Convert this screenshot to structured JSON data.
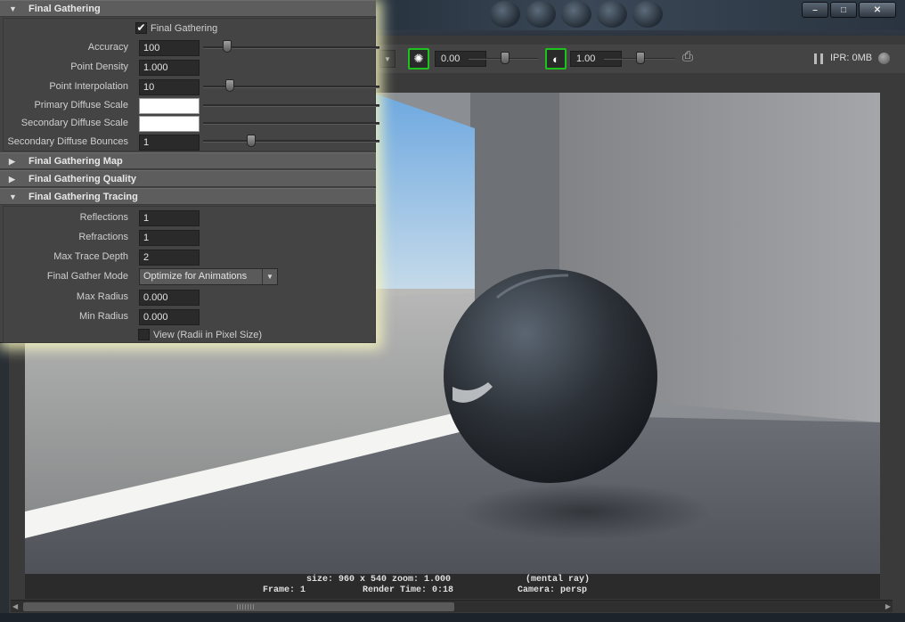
{
  "window": {
    "buttons": {
      "minimize": "–",
      "maximize": "□",
      "close": "✕"
    }
  },
  "toolbar": {
    "exposure_value": "0.00",
    "gamma_value": "1.00",
    "ipr_label": "IPR: 0MB"
  },
  "status": {
    "line1": "size: 960 x 540 zoom: 1.000",
    "renderer": "(mental ray)",
    "frame": "Frame: 1",
    "render_time": "Render Time: 0:18",
    "camera": "Camera: persp"
  },
  "panel": {
    "fg_header": "Final Gathering",
    "fg_checkbox_label": "Final Gathering",
    "fg_checkbox_checked": true,
    "rows": [
      {
        "label": "Accuracy",
        "value": "100",
        "slider": 0.15
      },
      {
        "label": "Point Density",
        "value": "1.000"
      },
      {
        "label": "Point Interpolation",
        "value": "10",
        "slider": 0.16
      },
      {
        "label": "Primary Diffuse Scale",
        "value": ""
      },
      {
        "label": "Secondary Diffuse Scale",
        "value": ""
      },
      {
        "label": "Secondary Diffuse Bounces",
        "value": "1",
        "slider": 0.29
      }
    ],
    "map_header": "Final Gathering Map",
    "quality_header": "Final Gathering Quality",
    "tracing_header": "Final Gathering Tracing",
    "tracing_rows": [
      {
        "label": "Reflections",
        "value": "1"
      },
      {
        "label": "Refractions",
        "value": "1"
      },
      {
        "label": "Max Trace Depth",
        "value": "2"
      }
    ],
    "gather_mode_label": "Final Gather Mode",
    "gather_mode_value": "Optimize for Animations",
    "max_radius_label": "Max Radius",
    "max_radius_value": "0.000",
    "min_radius_label": "Min Radius",
    "min_radius_value": "0.000",
    "view_checkbox_label": "View (Radii in Pixel Size)",
    "view_checkbox_checked": false
  },
  "icons": {
    "expanded": "expanded-triangle-icon",
    "collapsed": "collapsed-triangle-icon",
    "exposure": "exposure-icon",
    "gamma": "gamma-icon",
    "snapshot": "snapshot-icon",
    "pause": "pause-icon"
  },
  "colors": {
    "panel_bg": "#444444",
    "header_bg": "#5d5d5d",
    "highlight_glow": "#f5f5be",
    "toolbar_icon_border": "#1ec21e"
  }
}
